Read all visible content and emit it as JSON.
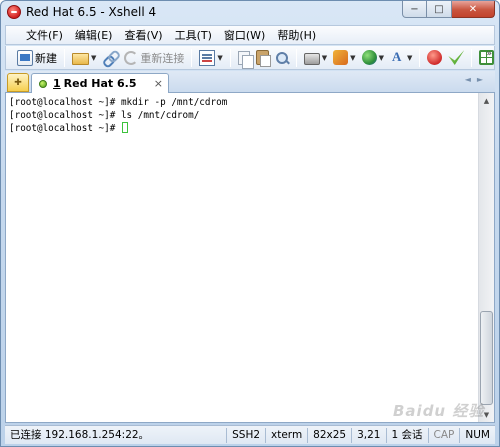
{
  "window": {
    "title": "Red Hat 6.5 - Xshell 4",
    "controls": {
      "minimize": "−",
      "maximize": "□",
      "close": "✕"
    }
  },
  "menu": {
    "items": [
      "文件(F)",
      "编辑(E)",
      "查看(V)",
      "工具(T)",
      "窗口(W)",
      "帮助(H)"
    ]
  },
  "toolbar": {
    "new_label": "新建",
    "reconnect_label": "重新连接"
  },
  "tabs": {
    "active": {
      "number": "1",
      "title": "Red Hat 6.5",
      "status_color": "#5cb82a"
    }
  },
  "terminal": {
    "lines": [
      "[root@localhost ~]# mkdir -p /mnt/cdrom",
      "[root@localhost ~]# ls /mnt/cdrom/",
      "[root@localhost ~]# "
    ],
    "cursor_color": "#3cc23c"
  },
  "status": {
    "connection": "已连接 192.168.1.254:22。",
    "protocol": "SSH2",
    "terminal_type": "xterm",
    "size": "82x25",
    "cursor_pos": "3,21",
    "sessions": "1 会话",
    "cap": "CAP",
    "num": "NUM"
  },
  "watermark": "Baidu 经验"
}
